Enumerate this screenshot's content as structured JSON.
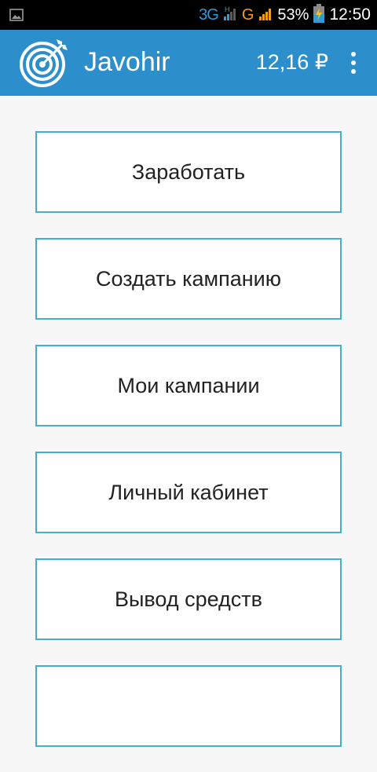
{
  "status_bar": {
    "network_3g": "3G",
    "network_h": "H",
    "network_g": "G",
    "battery": "53%",
    "time": "12:50"
  },
  "app_bar": {
    "title": "Javohir",
    "balance": "12,16 ₽"
  },
  "menu": {
    "items": [
      {
        "label": "Заработать"
      },
      {
        "label": "Создать кампанию"
      },
      {
        "label": "Мои кампании"
      },
      {
        "label": "Личный кабинет"
      },
      {
        "label": "Вывод средств"
      },
      {
        "label": ""
      }
    ]
  },
  "colors": {
    "app_bar": "#2c8fcc",
    "button_border": "#40b1d3",
    "background": "#f7f7f7"
  }
}
